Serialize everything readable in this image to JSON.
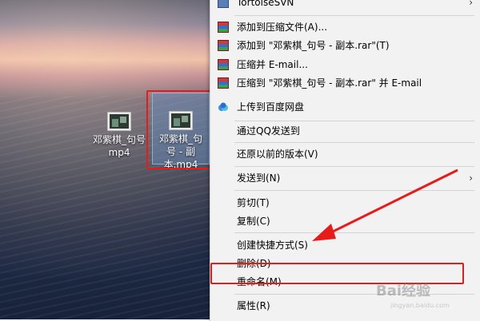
{
  "desktop": {
    "files": [
      {
        "label": "邓紫棋_句号.mp4",
        "line1": "邓紫棋_句号",
        "line2": "mp4"
      },
      {
        "label": "邓紫棋_句号 - 副本.mp4",
        "line1": "邓紫棋_句",
        "line2": "号 - 副本.mp4"
      }
    ]
  },
  "context_menu": {
    "items": [
      {
        "label": "TortoiseSVN",
        "icon": "svn-icon",
        "submenu": true
      },
      {
        "label": "添加到压缩文件(A)...",
        "icon": "winrar-icon"
      },
      {
        "label": "添加到 \"邓紫棋_句号 - 副本.rar\"(T)",
        "icon": "winrar-icon"
      },
      {
        "label": "压缩并 E-mail...",
        "icon": "winrar-icon"
      },
      {
        "label": "压缩到 \"邓紫棋_句号 - 副本.rar\" 并 E-mail",
        "icon": "winrar-icon"
      },
      {
        "label": "上传到百度网盘",
        "icon": "baidu-netdisk-icon"
      },
      {
        "label": "通过QQ发送到",
        "icon": ""
      },
      {
        "label": "还原以前的版本(V)",
        "icon": ""
      },
      {
        "label": "发送到(N)",
        "icon": "",
        "submenu": true
      },
      {
        "label": "剪切(T)",
        "icon": ""
      },
      {
        "label": "复制(C)",
        "icon": ""
      },
      {
        "label": "创建快捷方式(S)",
        "icon": ""
      },
      {
        "label": "删除(D)",
        "icon": ""
      },
      {
        "label": "重命名(M)",
        "icon": ""
      },
      {
        "label": "属性(R)",
        "icon": ""
      }
    ]
  },
  "annotations": {
    "highlight_color": "#e81b1b",
    "highlighted_item": "重命名(M)"
  },
  "watermark": {
    "text": "Bai经验",
    "sub": "jingyan.baidu.com"
  }
}
